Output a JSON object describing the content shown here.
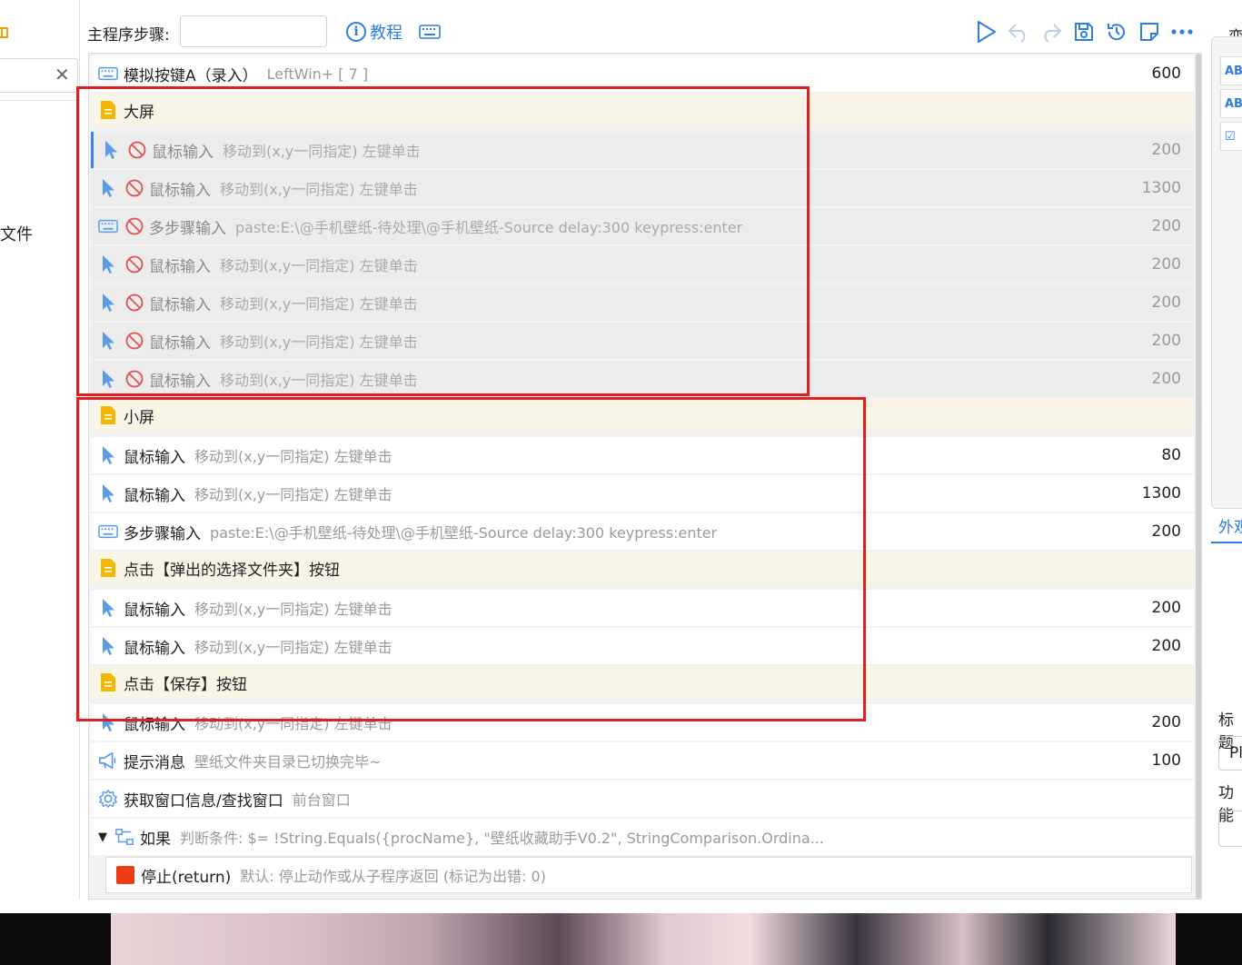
{
  "toolbar": {
    "step_label": "主程序步骤:",
    "step_input_value": "",
    "tutorial_label": "教程"
  },
  "left_panel": {
    "file_text": "定文件"
  },
  "steps": [
    {
      "type": "keyboard",
      "name": "模拟按键A（录入）",
      "desc": "LeftWin+ [ 7 ]",
      "delay": "600",
      "disabled": false
    },
    {
      "type": "group",
      "name": "大屏"
    },
    {
      "type": "mouse",
      "name": "鼠标输入",
      "desc": "移动到(x,y一同指定)   左键单击",
      "delay": "200",
      "disabled": true
    },
    {
      "type": "mouse",
      "name": "鼠标输入",
      "desc": "移动到(x,y一同指定)   左键单击",
      "delay": "1300",
      "disabled": true
    },
    {
      "type": "keyboard",
      "name": "多步骤输入",
      "desc": "paste:E:\\@手机壁纸-待处理\\@手机壁纸-Source  delay:300  keypress:enter",
      "delay": "200",
      "disabled": true
    },
    {
      "type": "mouse",
      "name": "鼠标输入",
      "desc": "移动到(x,y一同指定)   左键单击",
      "delay": "200",
      "disabled": true
    },
    {
      "type": "mouse",
      "name": "鼠标输入",
      "desc": "移动到(x,y一同指定)   左键单击",
      "delay": "200",
      "disabled": true
    },
    {
      "type": "mouse",
      "name": "鼠标输入",
      "desc": "移动到(x,y一同指定)   左键单击",
      "delay": "200",
      "disabled": true
    },
    {
      "type": "mouse",
      "name": "鼠标输入",
      "desc": "移动到(x,y一同指定)   左键单击",
      "delay": "200",
      "disabled": true
    },
    {
      "type": "group",
      "name": "小屏"
    },
    {
      "type": "mouse",
      "name": "鼠标输入",
      "desc": "移动到(x,y一同指定)   左键单击",
      "delay": "80",
      "disabled": false
    },
    {
      "type": "mouse",
      "name": "鼠标输入",
      "desc": "移动到(x,y一同指定)   左键单击",
      "delay": "1300",
      "disabled": false
    },
    {
      "type": "keyboard",
      "name": "多步骤输入",
      "desc": "paste:E:\\@手机壁纸-待处理\\@手机壁纸-Source  delay:300  keypress:enter",
      "delay": "200",
      "disabled": false
    },
    {
      "type": "group",
      "name": "点击【弹出的选择文件夹】按钮"
    },
    {
      "type": "mouse",
      "name": "鼠标输入",
      "desc": "移动到(x,y一同指定)   左键单击",
      "delay": "200",
      "disabled": false
    },
    {
      "type": "mouse",
      "name": "鼠标输入",
      "desc": "移动到(x,y一同指定)   左键单击",
      "delay": "200",
      "disabled": false
    },
    {
      "type": "group",
      "name": "点击【保存】按钮"
    },
    {
      "type": "mouse",
      "name": "鼠标输入",
      "desc": "移动到(x,y一同指定)   左键单击",
      "delay": "200",
      "disabled": false
    },
    {
      "type": "message",
      "name": "提示消息",
      "desc": "壁纸文件夹目录已切换完毕~",
      "delay": "100",
      "disabled": false
    },
    {
      "type": "window",
      "name": "获取窗口信息/查找窗口",
      "desc": "前台窗口",
      "delay": "",
      "disabled": false
    },
    {
      "type": "if",
      "name": "如果",
      "desc": "判断条件:  $= !String.Equals({procName}, \"壁纸收藏助手V0.2\", StringComparison.Ordina...",
      "delay": "",
      "disabled": false
    },
    {
      "type": "stop",
      "name": "停止(return)",
      "desc": "默认:  停止动作或从子程序返回 (标记为出错: 0)",
      "delay": "",
      "disabled": false
    }
  ],
  "right_panel": {
    "header": "变",
    "items": [
      "ABC",
      "ABC",
      "☑"
    ],
    "tab_label": "外观",
    "field1_label": "标题",
    "field1_value": "Pl",
    "field2_label": "功能"
  },
  "colors": {
    "accent": "#2e7de1",
    "highlight_box": "#e02020",
    "group_bg": "#f8f4e6",
    "disabled_bg": "#ececec",
    "folder_icon": "#f5b800",
    "stop_icon": "#f03c14"
  }
}
